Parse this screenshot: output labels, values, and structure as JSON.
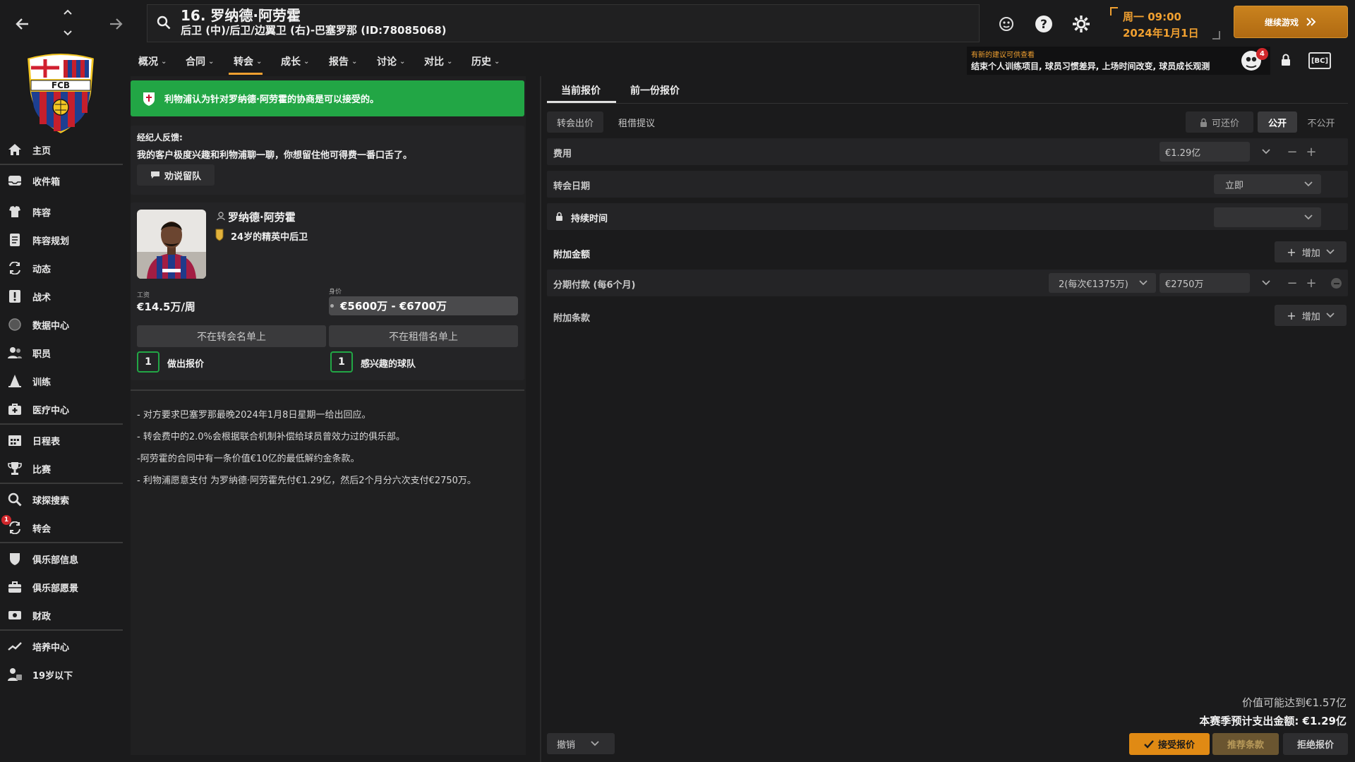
{
  "header": {
    "player_title": "16. 罗纳德·阿劳霍",
    "player_subtitle": "后卫 (中)/后卫/边翼卫 (右)-巴塞罗那 (ID:78085068)",
    "date_line1": "周一 09:00",
    "date_line2": "2024年1月1日",
    "continue_label": "继续游戏",
    "advice_title": "有新的建议可供查看",
    "advice_text": "结束个人训练项目, 球员习惯差异, 上场时间改变, 球员成长观测",
    "notif_count": "4",
    "fm_badge": "[BC]"
  },
  "subnav": [
    {
      "label": "概况"
    },
    {
      "label": "合同"
    },
    {
      "label": "转会"
    },
    {
      "label": "成长"
    },
    {
      "label": "报告"
    },
    {
      "label": "讨论"
    },
    {
      "label": "对比"
    },
    {
      "label": "历史"
    }
  ],
  "sidebar": {
    "club_logo_text": "FCB",
    "items": [
      {
        "label": "主页",
        "icon": "home-icon"
      },
      {
        "label": "收件箱",
        "icon": "inbox-icon"
      },
      {
        "label": "阵容",
        "icon": "squad-icon"
      },
      {
        "label": "阵容规划",
        "icon": "squad-planner-icon"
      },
      {
        "label": "动态",
        "icon": "dynamics-icon"
      },
      {
        "label": "战术",
        "icon": "tactics-icon"
      },
      {
        "label": "数据中心",
        "icon": "data-hub-icon"
      },
      {
        "label": "职员",
        "icon": "staff-icon"
      },
      {
        "label": "训练",
        "icon": "training-icon"
      },
      {
        "label": "医疗中心",
        "icon": "medical-icon"
      },
      {
        "label": "日程表",
        "icon": "calendar-icon"
      },
      {
        "label": "比赛",
        "icon": "trophy-icon"
      },
      {
        "label": "球探搜索",
        "icon": "scouting-icon"
      },
      {
        "label": "转会",
        "icon": "transfers-icon",
        "badge": "1"
      },
      {
        "label": "俱乐部信息",
        "icon": "club-info-icon"
      },
      {
        "label": "俱乐部愿景",
        "icon": "club-vision-icon"
      },
      {
        "label": "财政",
        "icon": "finances-icon"
      },
      {
        "label": "培养中心",
        "icon": "development-icon"
      },
      {
        "label": "19岁以下",
        "icon": "u19-icon"
      }
    ]
  },
  "left": {
    "banner_text": "利物浦认为针对罗纳德·阿劳霍的协商是可以接受的。",
    "agent_title": "经纪人反馈:",
    "agent_text": "我的客户极度兴趣和利物浦聊一聊，你想留住他可得费一番口舌了。",
    "persuade_label": "劝说留队",
    "player_name": "罗纳德·阿劳霍",
    "player_desc": "24岁的精英中后卫",
    "wage_label": "工资",
    "wage_value": "€14.5万/周",
    "value_label": "身价",
    "value_range": "€5600万 - €6700万",
    "not_transfer_listed": "不在转会名单上",
    "not_loan_listed": "不在租借名单上",
    "offers_count": "1",
    "offers_label": "做出报价",
    "interested_count": "1",
    "interested_label": "感兴趣的球队",
    "notes": [
      "- 对方要求巴塞罗那最晚2024年1月8日星期一给出回应。",
      "- 转会费中的2.0%会根据联合机制补偿给球员曾效力过的俱乐部。",
      "-阿劳霍的合同中有一条价值€10亿的最低解约金条款。",
      "- 利物浦愿意支付 为罗纳德·阿劳霍先付€1.29亿，然后2个月分六次支付€2750万。"
    ]
  },
  "right": {
    "tabs": [
      "当前报价",
      "前一份报价"
    ],
    "subtabs": [
      "转会出价",
      "租借提议"
    ],
    "negotiable_label": "可还价",
    "public_label": "公开",
    "private_label": "不公开",
    "fee_label": "费用",
    "fee_value": "€1.29亿",
    "date_label": "转会日期",
    "date_value": "立即",
    "duration_label": "持续时间",
    "addons_label": "附加金额",
    "add_label": "增加",
    "installment_label": "分期付款 (每6个月)",
    "installment_count": "2(每次€1375万)",
    "installment_value": "€2750万",
    "clauses_label": "附加条款",
    "potential_value": "价值可能达到€1.57亿",
    "season_spend": "本赛季预计支出金额: €1.29亿",
    "cancel_label": "撤销",
    "accept_label": "接受报价",
    "suggest_label": "推荐条款",
    "reject_label": "拒绝报价"
  },
  "colors": {
    "accent": "#f0a030",
    "success": "#22a645",
    "background": "#1b1b1c",
    "panel": "#202021",
    "alert_red": "#d0272b"
  }
}
